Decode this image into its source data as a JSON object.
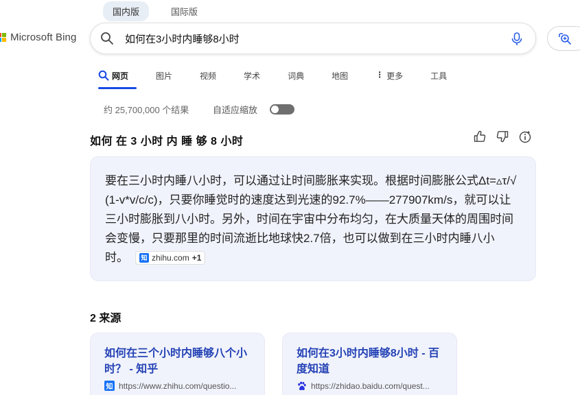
{
  "region_tabs": [
    {
      "label": "国内版",
      "active": true
    },
    {
      "label": "国际版",
      "active": false
    }
  ],
  "logo": {
    "text": "Microsoft Bing",
    "colors": [
      "#f25022",
      "#7fba00",
      "#00a4ef",
      "#ffb900"
    ]
  },
  "search": {
    "query": "如何在3小时内睡够8小时",
    "icon": "search-icon",
    "mic_icon": "microphone-icon"
  },
  "visual_search": {
    "icon": "visual-search-icon"
  },
  "nav": {
    "items": [
      {
        "label": "网页",
        "active": true,
        "icon": "search-icon"
      },
      {
        "label": "图片"
      },
      {
        "label": "视频"
      },
      {
        "label": "学术"
      },
      {
        "label": "词典"
      },
      {
        "label": "地图"
      },
      {
        "label": "更多",
        "icon": "more-dots-icon"
      },
      {
        "label": "工具"
      }
    ]
  },
  "results": {
    "count_text": "约 25,700,000 个结果",
    "adaptive_zoom_label": "自适应缩放",
    "adaptive_zoom_on": false
  },
  "answer": {
    "title": "如何 在 3 小时 内 睡 够 8 小时",
    "text": "要在三小时内睡八小时，可以通过让时间膨胀来实现。根据时间膨胀公式Δt=▵τ/√ (1-v*v/c/c)，只要你睡觉时的速度达到光速的92.7%——277907km/s，就可以让三小时膨胀到八小时。另外，时间在宇宙中分布均匀，在大质量天体的周围时间会变慢，只要那里的时间流逝比地球快2.7倍，也可以做到在三小时内睡八小时。",
    "citation": {
      "icon_label": "知",
      "domain": "zhihu.com",
      "more": "+1"
    },
    "feedback_icons": [
      "thumbs-up-icon",
      "thumbs-down-icon",
      "info-icon"
    ]
  },
  "sources": {
    "heading": "2 来源",
    "items": [
      {
        "title": "如何在三个小时内睡够八个小时？ - 知乎",
        "url": "https://www.zhihu.com/questio...",
        "favicon_label": "知"
      },
      {
        "title": "如何在3小时内睡够8小时 - 百度知道",
        "url": "https://zhidao.baidu.com/quest...",
        "favicon": "baidu-paw-icon"
      }
    ]
  }
}
